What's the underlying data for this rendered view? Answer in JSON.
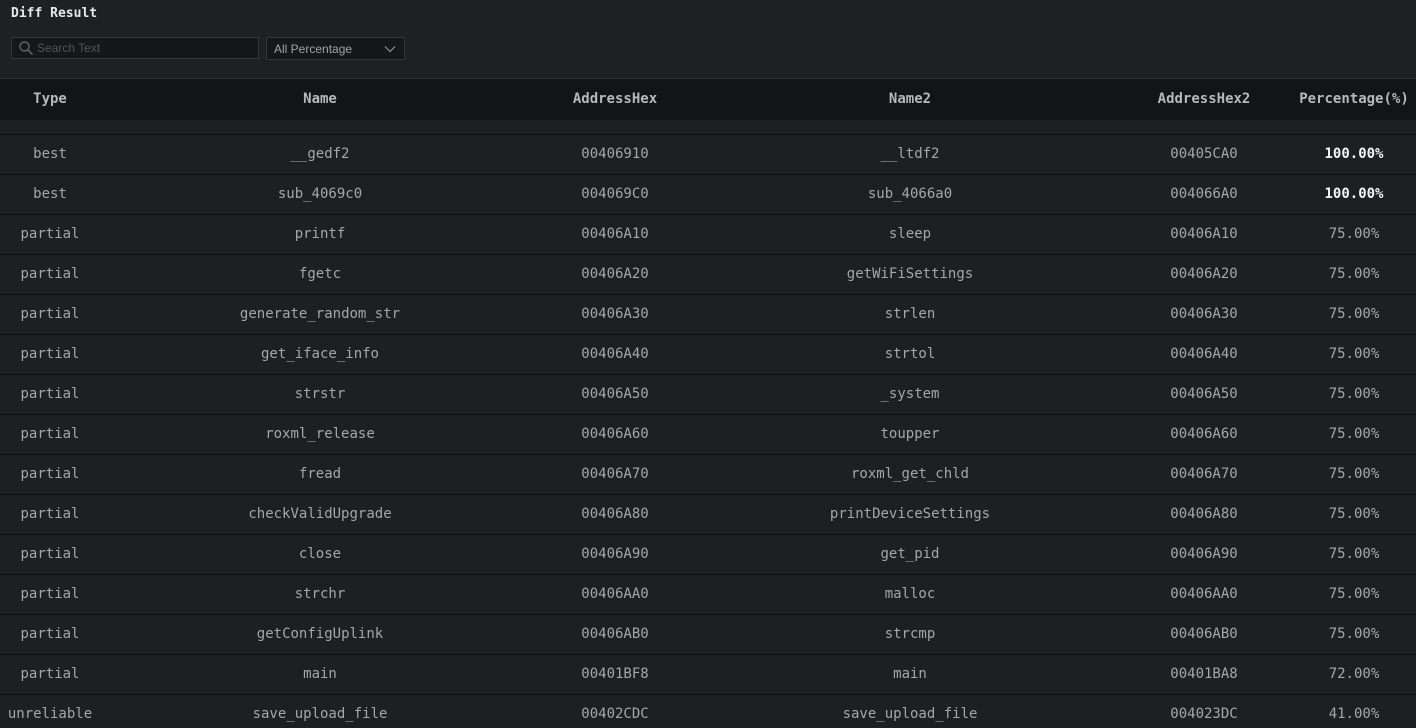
{
  "panel": {
    "title": "Diff Result",
    "search_placeholder": "Search Text",
    "filter_selected": "All Percentage"
  },
  "columns": [
    "Type",
    "Name",
    "AddressHex",
    "Name2",
    "AddressHex2",
    "Percentage(%)"
  ],
  "rows": [
    {
      "type": "best",
      "name": "__gedf2",
      "addr": "00406910",
      "name2": "__ltdf2",
      "addr2": "00405CA0",
      "pct": "100.00%",
      "highlight": true
    },
    {
      "type": "best",
      "name": "sub_4069c0",
      "addr": "004069C0",
      "name2": "sub_4066a0",
      "addr2": "004066A0",
      "pct": "100.00%",
      "highlight": true
    },
    {
      "type": "partial",
      "name": "printf",
      "addr": "00406A10",
      "name2": "sleep",
      "addr2": "00406A10",
      "pct": "75.00%",
      "highlight": false
    },
    {
      "type": "partial",
      "name": "fgetc",
      "addr": "00406A20",
      "name2": "getWiFiSettings",
      "addr2": "00406A20",
      "pct": "75.00%",
      "highlight": false
    },
    {
      "type": "partial",
      "name": "generate_random_str",
      "addr": "00406A30",
      "name2": "strlen",
      "addr2": "00406A30",
      "pct": "75.00%",
      "highlight": false
    },
    {
      "type": "partial",
      "name": "get_iface_info",
      "addr": "00406A40",
      "name2": "strtol",
      "addr2": "00406A40",
      "pct": "75.00%",
      "highlight": false
    },
    {
      "type": "partial",
      "name": "strstr",
      "addr": "00406A50",
      "name2": "_system",
      "addr2": "00406A50",
      "pct": "75.00%",
      "highlight": false
    },
    {
      "type": "partial",
      "name": "roxml_release",
      "addr": "00406A60",
      "name2": "toupper",
      "addr2": "00406A60",
      "pct": "75.00%",
      "highlight": false
    },
    {
      "type": "partial",
      "name": "fread",
      "addr": "00406A70",
      "name2": "roxml_get_chld",
      "addr2": "00406A70",
      "pct": "75.00%",
      "highlight": false
    },
    {
      "type": "partial",
      "name": "checkValidUpgrade",
      "addr": "00406A80",
      "name2": "printDeviceSettings",
      "addr2": "00406A80",
      "pct": "75.00%",
      "highlight": false
    },
    {
      "type": "partial",
      "name": "close",
      "addr": "00406A90",
      "name2": "get_pid",
      "addr2": "00406A90",
      "pct": "75.00%",
      "highlight": false
    },
    {
      "type": "partial",
      "name": "strchr",
      "addr": "00406AA0",
      "name2": "malloc",
      "addr2": "00406AA0",
      "pct": "75.00%",
      "highlight": false
    },
    {
      "type": "partial",
      "name": "getConfigUplink",
      "addr": "00406AB0",
      "name2": "strcmp",
      "addr2": "00406AB0",
      "pct": "75.00%",
      "highlight": false
    },
    {
      "type": "partial",
      "name": "main",
      "addr": "00401BF8",
      "name2": "main",
      "addr2": "00401BA8",
      "pct": "72.00%",
      "highlight": false
    },
    {
      "type": "unreliable",
      "name": "save_upload_file",
      "addr": "00402CDC",
      "name2": "save_upload_file",
      "addr2": "004023DC",
      "pct": "41.00%",
      "highlight": false
    }
  ]
}
